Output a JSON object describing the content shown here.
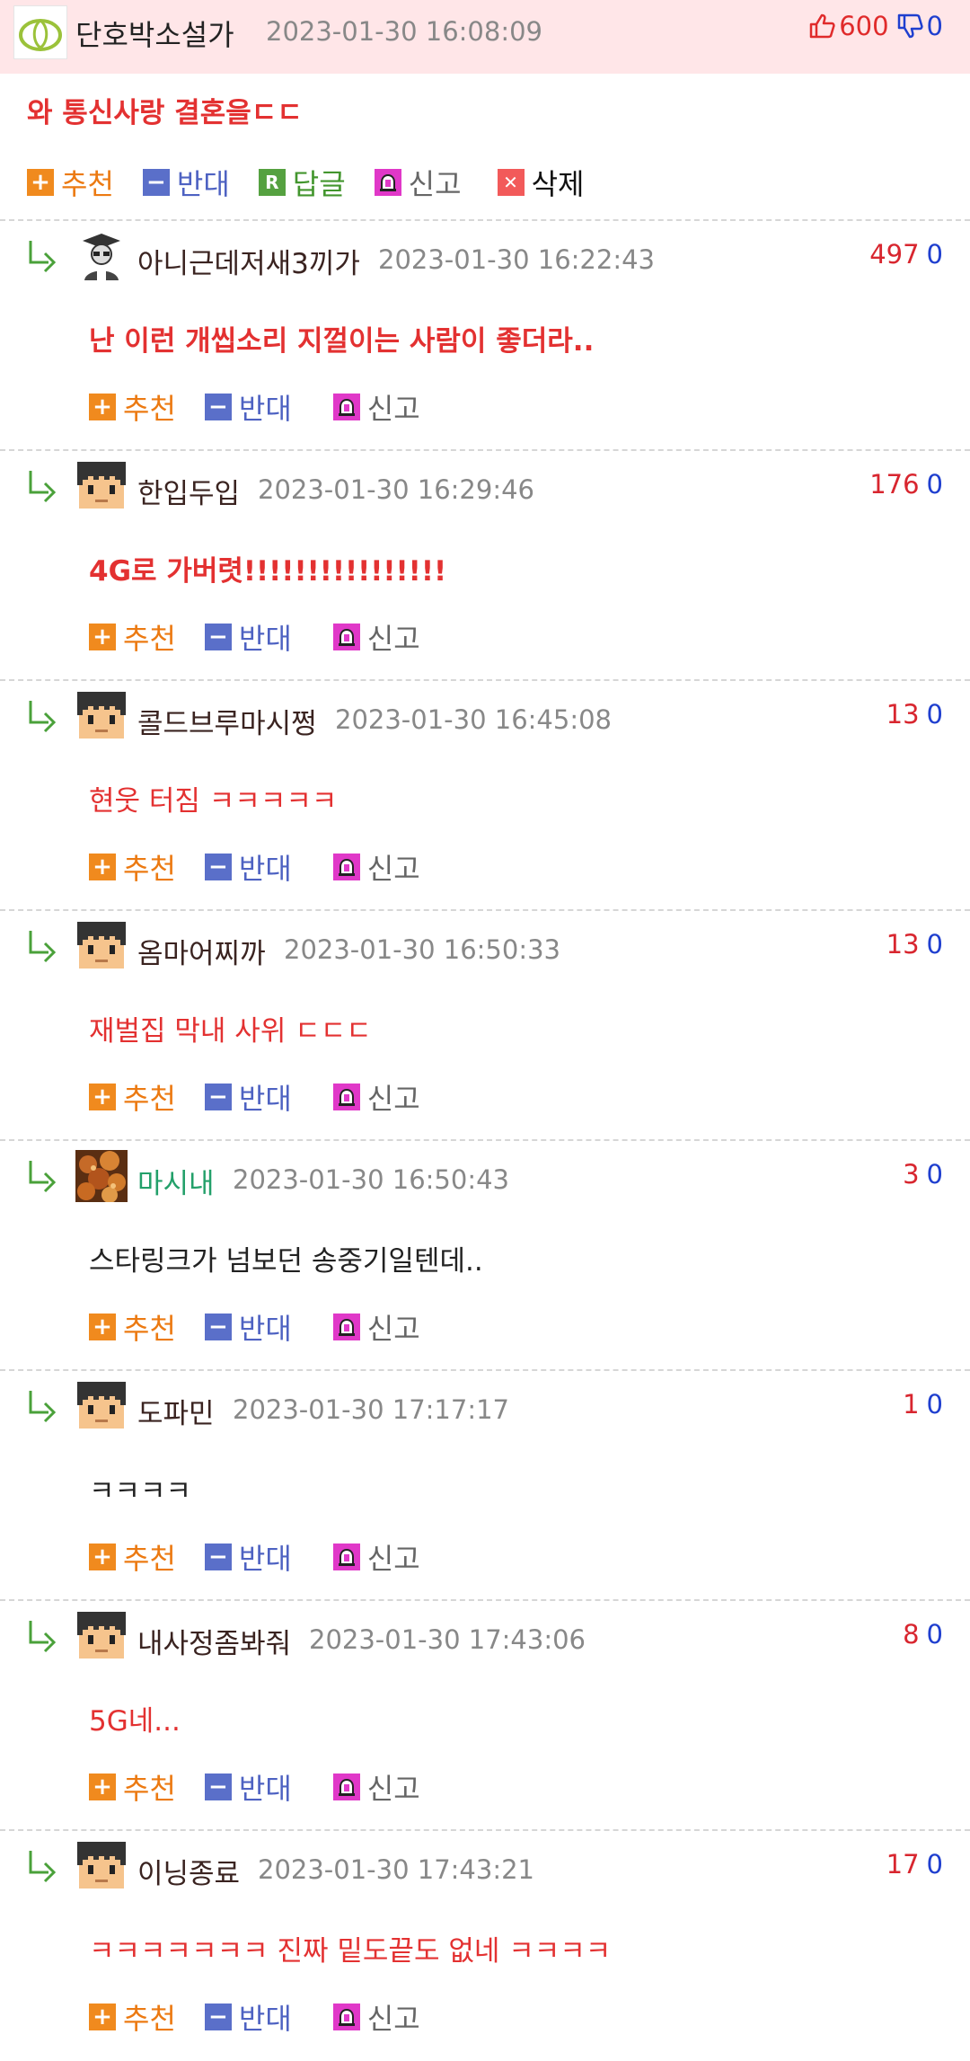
{
  "post": {
    "author": "단호박소설가",
    "date": "2023-01-30 16:08:09",
    "upvotes": "600",
    "downvotes": "0",
    "title": "와 통신사랑 결혼을ㄷㄷ",
    "actions": {
      "up": "추천",
      "down": "반대",
      "reply_icon": "R",
      "reply": "답글",
      "report": "신고",
      "delete_icon": "✕",
      "delete": "삭제"
    }
  },
  "comment_actions": {
    "up": "추천",
    "down": "반대",
    "report": "신고"
  },
  "comments": [
    {
      "author": "아니근데저새3끼가",
      "date": "2023-01-30 16:22:43",
      "up": "497",
      "down": "0",
      "text": "난 이런 개씹소리 지껄이는 사람이 좋더라..",
      "style": "bold-red",
      "avatar": "hacker-avatar-icon"
    },
    {
      "author": "한입두입",
      "date": "2023-01-30 16:29:46",
      "up": "176",
      "down": "0",
      "text": "4G로 가버렷!!!!!!!!!!!!!!!!",
      "style": "bold-red",
      "avatar": "pixel-face-avatar-icon"
    },
    {
      "author": "콜드브루마시쩡",
      "date": "2023-01-30 16:45:08",
      "up": "13",
      "down": "0",
      "text": "현웃 터짐 ㅋㅋㅋㅋㅋ",
      "style": "red",
      "avatar": "pixel-face-avatar-icon"
    },
    {
      "author": "옴마어찌까",
      "date": "2023-01-30 16:50:33",
      "up": "13",
      "down": "0",
      "text": "재벌집 막내 사위 ㄷㄷㄷ",
      "style": "red",
      "avatar": "pixel-face-avatar-icon"
    },
    {
      "author": "마시내",
      "date": "2023-01-30 16:50:43",
      "up": "3",
      "down": "0",
      "text": "스타링크가 넘보던 송중기일텐데..",
      "style": "dark",
      "avatar": "food-photo-avatar-icon"
    },
    {
      "author": "도파민",
      "date": "2023-01-30 17:17:17",
      "up": "1",
      "down": "0",
      "text": "ㅋㅋㅋㅋ",
      "style": "dark",
      "avatar": "pixel-face-avatar-icon"
    },
    {
      "author": "내사정좀봐줘",
      "date": "2023-01-30 17:43:06",
      "up": "8",
      "down": "0",
      "text": "5G네...",
      "style": "red",
      "avatar": "pixel-face-avatar-icon"
    },
    {
      "author": "이닝종료",
      "date": "2023-01-30 17:43:21",
      "up": "17",
      "down": "0",
      "text": "ㅋㅋㅋㅋㅋㅋㅋ 진짜 밑도끝도 없네 ㅋㅋㅋㅋ",
      "style": "red",
      "avatar": "pixel-face-avatar-icon"
    }
  ],
  "colors": {
    "header_bg": "#ffe6e8",
    "accent_red": "#e33131",
    "vote_blue": "#1f3fcf",
    "up_orange": "#f08a1e",
    "down_blue": "#5a6fc9"
  }
}
